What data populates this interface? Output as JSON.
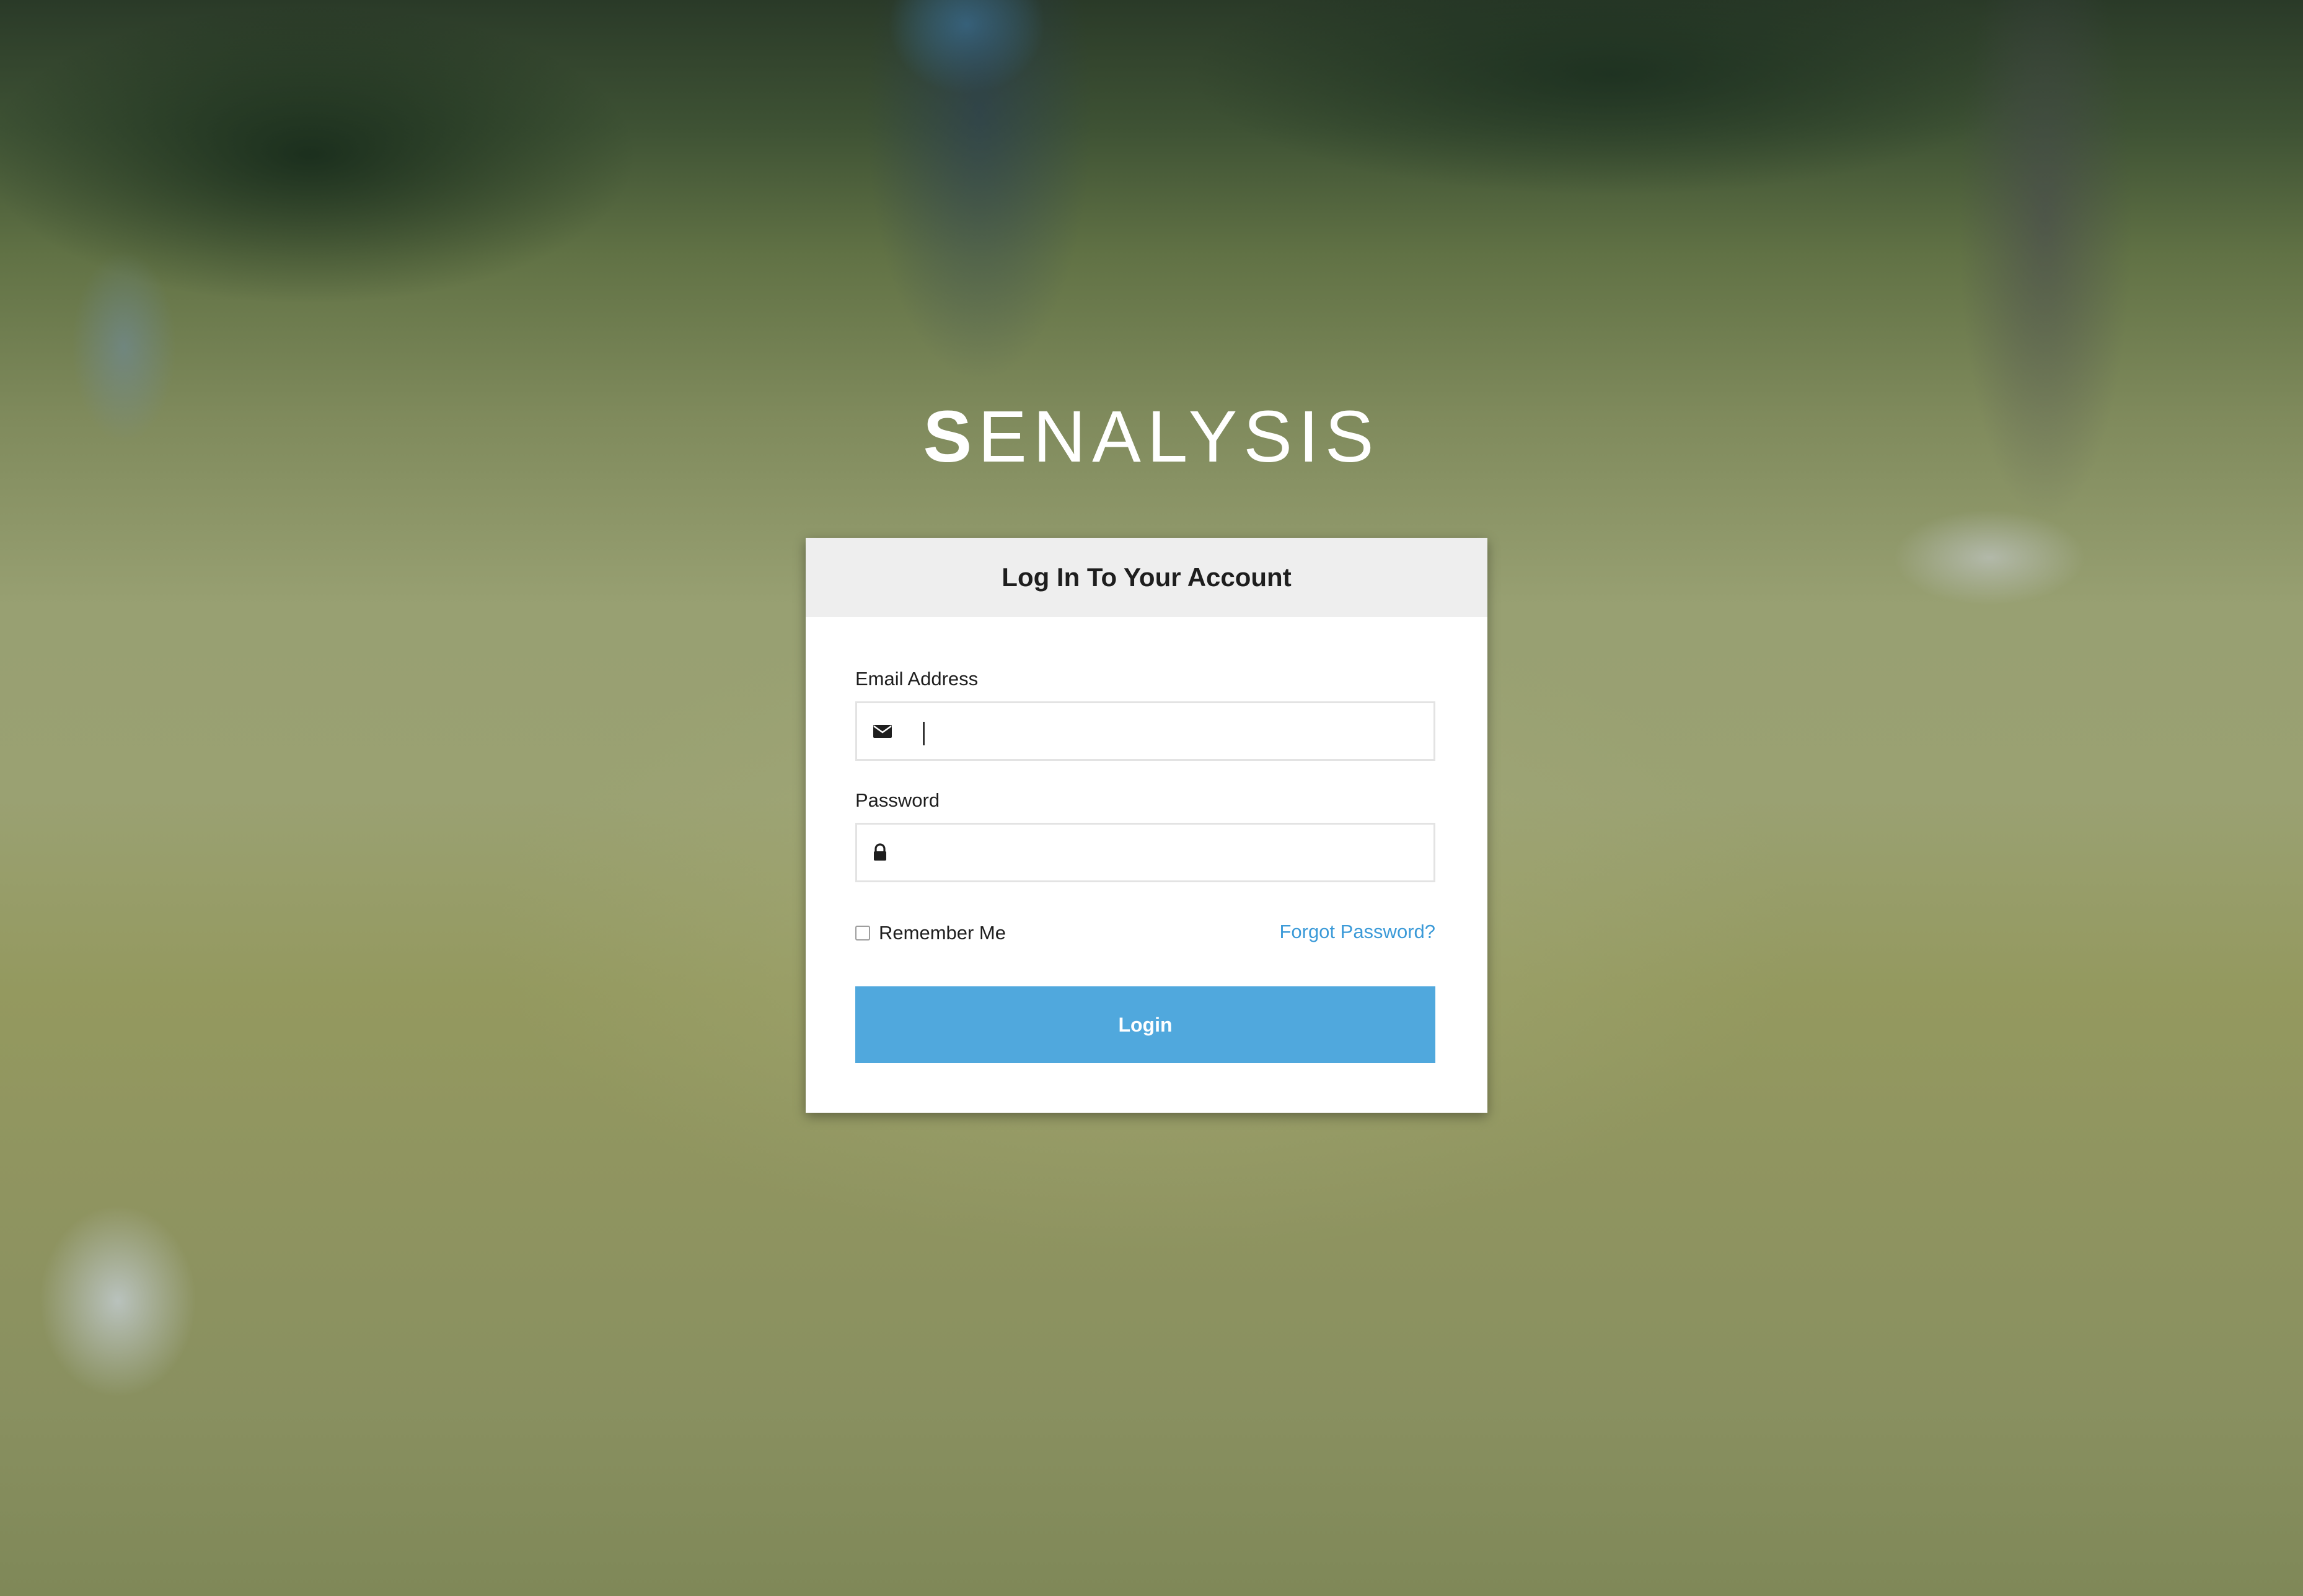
{
  "brand": {
    "logo_first": "S",
    "logo_rest": "ENALYSIS"
  },
  "login_form": {
    "title": "Log In To Your Account",
    "email": {
      "label": "Email Address",
      "value": "",
      "placeholder": "",
      "icon": "envelope-icon"
    },
    "password": {
      "label": "Password",
      "value": "",
      "placeholder": "",
      "icon": "lock-icon"
    },
    "remember_me": {
      "label": "Remember Me",
      "checked": false
    },
    "forgot_password": "Forgot Password?",
    "submit_label": "Login"
  },
  "colors": {
    "primary_button": "#50a8dd",
    "link": "#3b9ad8",
    "header_bg": "#eeeeee"
  }
}
